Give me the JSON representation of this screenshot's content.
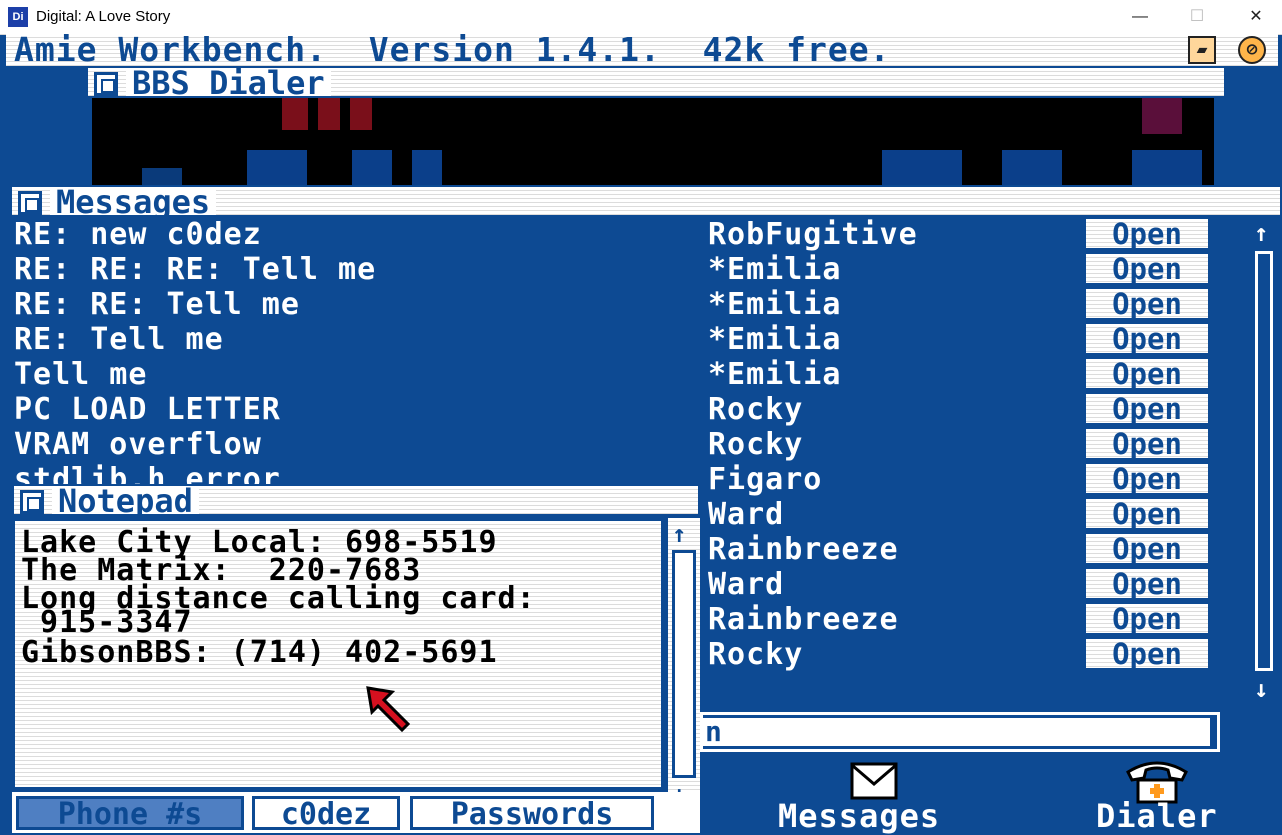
{
  "window": {
    "logo": "Di",
    "title": "Digital: A Love Story",
    "minimize": "—",
    "maximize": "☐",
    "close": "✕"
  },
  "workbench": {
    "header": "Amie Workbench.  Version 1.4.1.  42k free."
  },
  "dialer": {
    "title": "BBS Dialer"
  },
  "messages": {
    "title": "Messages",
    "open_label": "Open",
    "rows": [
      {
        "subject": "RE: new c0dez",
        "from": "RobFugitive"
      },
      {
        "subject": "RE: RE: RE: Tell me",
        "from": "*Emilia"
      },
      {
        "subject": "RE: RE: Tell me",
        "from": "*Emilia"
      },
      {
        "subject": "RE: Tell me",
        "from": "*Emilia"
      },
      {
        "subject": "Tell me",
        "from": "*Emilia"
      },
      {
        "subject": "PC LOAD LETTER",
        "from": "Rocky"
      },
      {
        "subject": "VRAM overflow",
        "from": "Rocky"
      },
      {
        "subject": "stdlib.h error",
        "from": "Figaro"
      },
      {
        "subject": "",
        "from": "Ward"
      },
      {
        "subject": "",
        "from": "Rainbreeze"
      },
      {
        "subject": "",
        "from": "Ward"
      },
      {
        "subject": "",
        "from": "Rainbreeze"
      },
      {
        "subject": "",
        "from": "Rocky"
      }
    ],
    "scroll_up": "↑",
    "scroll_down": "↓"
  },
  "command": {
    "value": "n"
  },
  "notepad": {
    "title": "Notepad",
    "lines": [
      "Lake City Local: 698-5519",
      "The Matrix:  220-7683",
      "Long distance calling card:",
      " 915-3347",
      "GibsonBBS: (714) 402-5691"
    ],
    "tabs": [
      "Phone #s",
      "c0dez",
      "Passwords"
    ],
    "active_tab": "Phone #s",
    "scroll_up": "↑",
    "scroll_down": "↓"
  },
  "taskbar": {
    "messages_label": "Messages",
    "dialer_label": "Dialer"
  },
  "icons": {
    "disk": "disk-icon",
    "no_entry": "no-entry-icon",
    "envelope": "envelope-icon",
    "telephone": "telephone-icon",
    "cursor": "pointer-arrow-icon"
  }
}
